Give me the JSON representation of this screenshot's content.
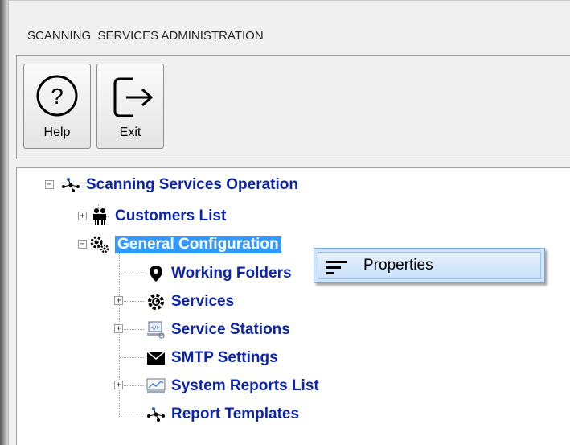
{
  "window": {
    "title": "SCANNING  SERVICES ADMINISTRATION"
  },
  "toolbar": {
    "help_label": "Help",
    "exit_label": "Exit"
  },
  "tree": {
    "root": {
      "label": "Scanning Services Operation",
      "icon": "network-icon"
    },
    "customers": {
      "label": "Customers List",
      "icon": "people-icon"
    },
    "general": {
      "label": "General Configuration",
      "icon": "gears-icon",
      "selected": true
    },
    "children": [
      {
        "label": "Working Folders",
        "icon": "location-pin-icon"
      },
      {
        "label": "Services",
        "icon": "service-gear-icon"
      },
      {
        "label": "Service Stations",
        "icon": "workstation-icon"
      },
      {
        "label": "SMTP Settings",
        "icon": "envelope-icon"
      },
      {
        "label": "System Reports List",
        "icon": "report-chart-icon"
      },
      {
        "label": "Report Templates",
        "icon": "network-icon"
      }
    ]
  },
  "context_menu": {
    "items": [
      {
        "label": "Properties",
        "icon": "properties-lines-icon"
      }
    ]
  },
  "colors": {
    "tree_text": "#0b24a8",
    "selection": "#3399ff",
    "menu_hover": "#cfe4fb"
  }
}
